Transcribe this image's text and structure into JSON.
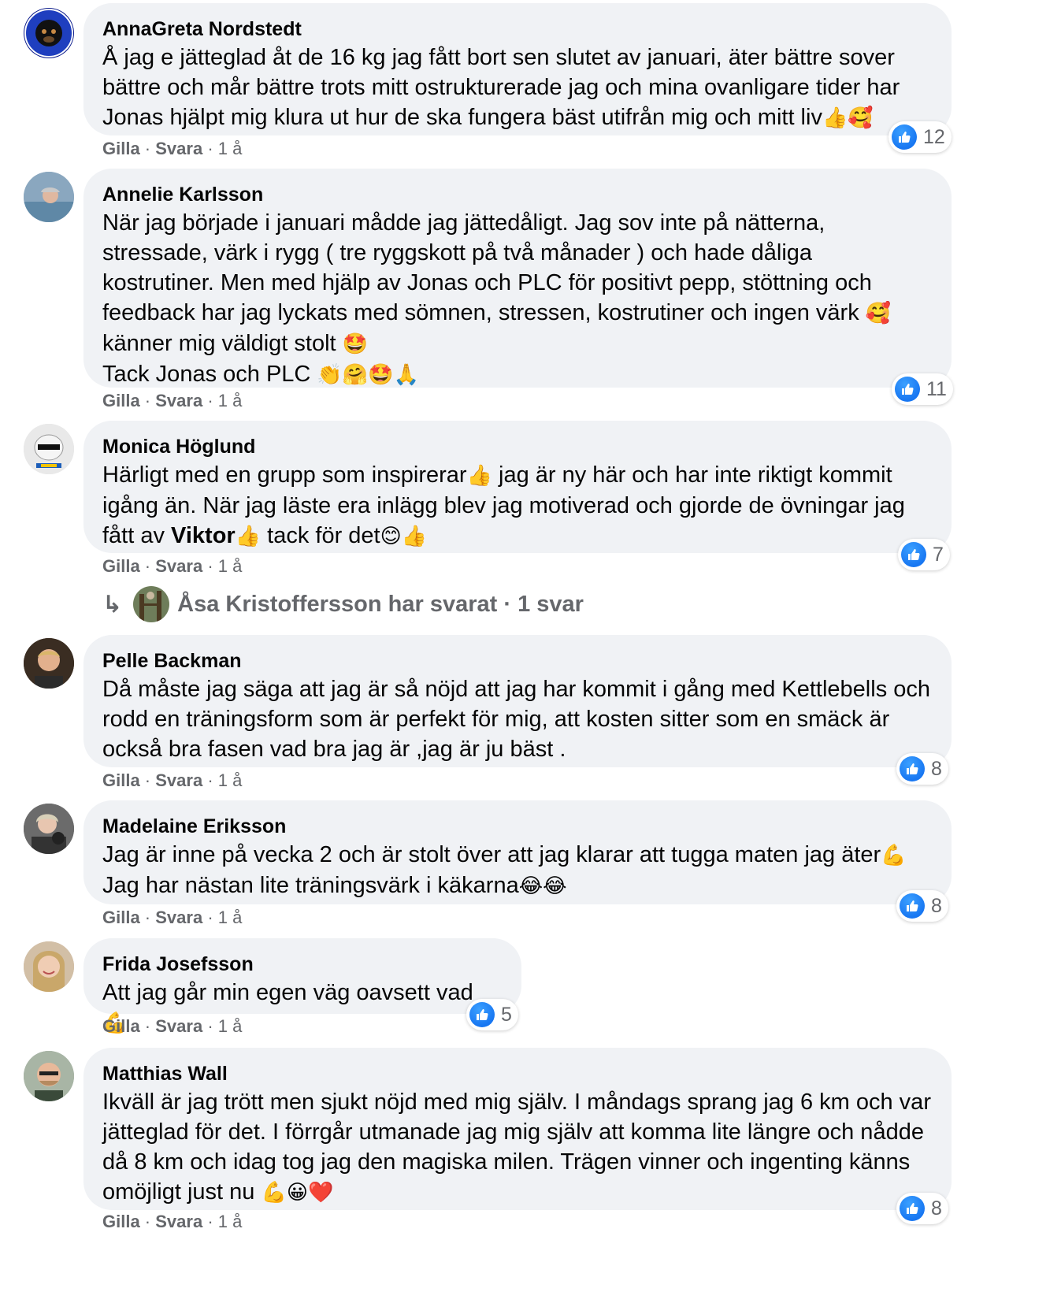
{
  "colors": {
    "accent": "#1877f2",
    "bubble": "#f0f2f5",
    "meta": "#65676b"
  },
  "comments": [
    {
      "author": "AnnaGreta Nordstedt",
      "lines": [
        "Å jag e jätteglad åt de 16 kg jag fått bort sen slutet av januari, äter bättre sover",
        "bättre och mår bättre trots mitt ostrukturerade jag och mina ovanligare tider har",
        "Jonas hjälpt mig klura ut hur de ska fungera bäst utifrån mig och mitt liv"
      ],
      "emojis": [
        "👍",
        "🥰"
      ],
      "likes": "12",
      "like_label": "Gilla",
      "reply_label": "Svara",
      "time": "1 å"
    },
    {
      "author": "Annelie Karlsson",
      "lines": [
        "När jag började i januari mådde jag jättedåligt. Jag sov inte på nätterna,",
        "stressade, värk i rygg ( tre ryggskott på två månader ) och hade dåliga",
        "kostrutiner. Men med hjälp av Jonas och PLC för positivt pepp, stöttning och",
        "feedback har jag lyckats med sömnen, stressen, kostrutiner och ingen värk",
        "känner mig väldigt stolt",
        "Tack Jonas och PLC"
      ],
      "emojis_line4": "🥰",
      "emojis_line5": "🤩",
      "emojis_line6": "👏🤗🤩🙏",
      "likes": "11",
      "like_label": "Gilla",
      "reply_label": "Svara",
      "time": "1 å"
    },
    {
      "author": "Monica Höglund",
      "line1": "Härligt med en grupp som inspirerar",
      "line1_emoji": "👍",
      "line1_rest": " jag är ny här och har inte riktigt kommit",
      "line2": "igång än. När jag läste era inlägg blev jag motiverad och gjorde de övningar jag",
      "line3_pre": "fått av ",
      "line3_bold": "Viktor",
      "line3_emoji1": "👍",
      "line3_mid": " tack för det",
      "line3_emoji2": "😊👍",
      "likes": "7",
      "like_label": "Gilla",
      "reply_label": "Svara",
      "time": "1 å",
      "replies_text": "Åsa Kristoffersson har svarat · 1 svar"
    },
    {
      "author": "Pelle Backman",
      "lines": [
        "Då måste jag säga att jag är så nöjd att jag har kommit i gång med Kettlebells och",
        "rodd en träningsform som är perfekt för mig, att kosten sitter som en smäck är",
        "också bra fasen vad bra jag är ,jag är ju bäst ."
      ],
      "likes": "8",
      "like_label": "Gilla",
      "reply_label": "Svara",
      "time": "1 å"
    },
    {
      "author": "Madelaine Eriksson",
      "lines": [
        "Jag är inne på vecka 2 och är stolt över att jag klarar att tugga maten jag äter",
        "Jag har nästan lite träningsvärk i käkarna"
      ],
      "emoji_line1": "💪",
      "emoji_line2": "😂😂",
      "likes": "8",
      "like_label": "Gilla",
      "reply_label": "Svara",
      "time": "1 å"
    },
    {
      "author": "Frida Josefsson",
      "lines": [
        "Att jag går min egen väg oavsett vad "
      ],
      "emoji_line1": "💪",
      "likes": "5",
      "like_label": "Gilla",
      "reply_label": "Svara",
      "time": "1 å"
    },
    {
      "author": "Matthias Wall",
      "lines": [
        "Ikväll är jag trött men sjukt nöjd med mig själv. I måndags sprang jag 6 km och var",
        "jätteglad för det. I förrgår utmanade jag mig själv att komma lite längre och nådde",
        "då 8 km och idag tog jag den magiska milen. Trägen vinner och ingenting känns",
        "omöjligt just nu "
      ],
      "emoji_line4": "💪😀❤️",
      "likes": "8",
      "like_label": "Gilla",
      "reply_label": "Svara",
      "time": "1 å"
    }
  ]
}
